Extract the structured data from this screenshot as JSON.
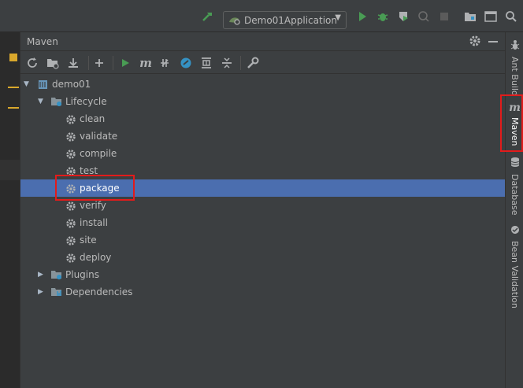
{
  "toolbar": {
    "run_config": "Demo01Application",
    "icons": [
      "hammer-icon",
      "run-config-icon",
      "run-icon",
      "debug-icon",
      "coverage-icon",
      "profile-icon",
      "stop-icon",
      "project-structure-icon",
      "layout-icon",
      "search-icon"
    ]
  },
  "panel": {
    "title": "Maven",
    "header_icons": [
      "gear-icon",
      "minimize-icon"
    ],
    "toolbar_icons": [
      "refresh-icon",
      "generate-sources-icon",
      "download-icon",
      "add-icon",
      "run-icon",
      "maven-icon",
      "toggle-offline-icon",
      "skip-tests-icon",
      "show-dependencies-icon",
      "collapse-icon",
      "settings-wrench-icon"
    ]
  },
  "tree": {
    "project": "demo01",
    "lifecycle": "Lifecycle",
    "goals": [
      "clean",
      "validate",
      "compile",
      "test",
      "package",
      "verify",
      "install",
      "site",
      "deploy"
    ],
    "selected_goal": "package",
    "plugins": "Plugins",
    "dependencies": "Dependencies"
  },
  "sidebar": {
    "tabs": [
      {
        "label": "Ant Build",
        "icon": "ant-icon"
      },
      {
        "label": "Maven",
        "icon": "maven-icon"
      },
      {
        "label": "Database",
        "icon": "database-icon"
      },
      {
        "label": "Bean Validation",
        "icon": "bean-validation-icon"
      }
    ]
  },
  "colors": {
    "background": "#2b2b2b",
    "panel": "#3c3f41",
    "selection": "#4b6eaf",
    "run_green": "#499c54",
    "highlight_red": "#e21b1b"
  }
}
